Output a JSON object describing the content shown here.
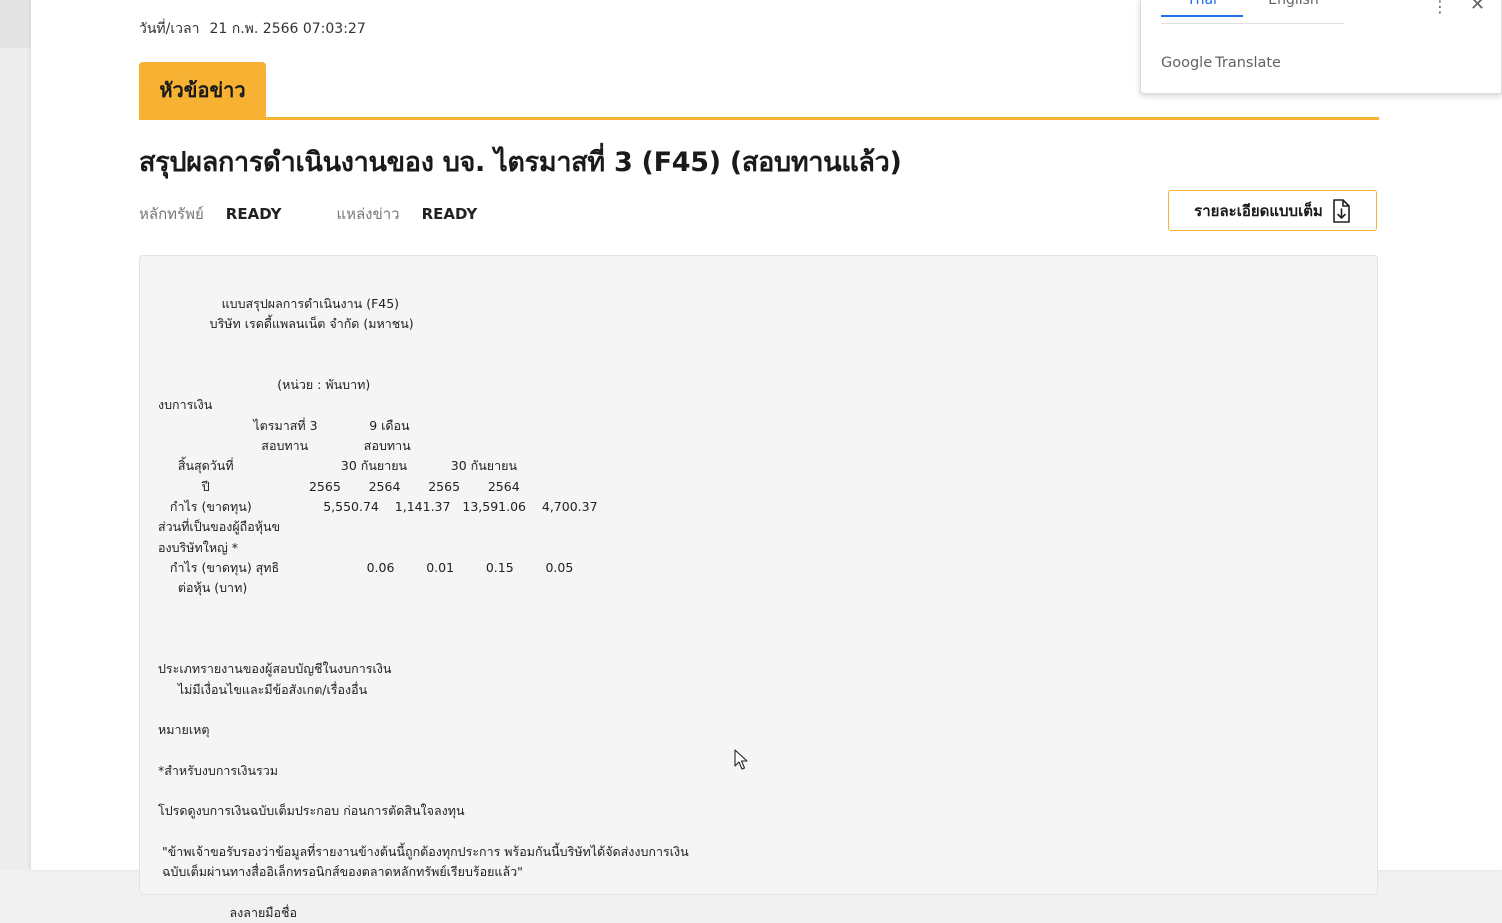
{
  "news": {
    "datetime_label": "วันที่/เวลา",
    "datetime_value": "21 ก.พ. 2566 07:03:27",
    "headline_tab": "หัวข้อข่าว",
    "title": "สรุปผลการดำเนินงานของ บจ. ไตรมาสที่ 3 (F45) (สอบทานแล้ว)",
    "security_label": "หลักทรัพย์",
    "security_value": "READY",
    "source_label": "แหล่งข่าว",
    "source_value": "READY",
    "full_detail_button": "รายละเอียดแบบเต็ม",
    "full_detail_icon": "document-download-icon"
  },
  "report_lines": [
    "                แบบสรุปผลการดำเนินงาน (F45)",
    "             บริษัท เรดดี้แพลนเน็ต จำกัด (มหาชน)",
    "",
    "",
    "                              (หน่วย : พันบาท)",
    "งบการเงิน",
    "                        ไตรมาสที่ 3             9 เดือน",
    "                          สอบทาน              สอบทาน",
    "     สิ้นสุดวันที่                           30 กันยายน           30 กันยายน",
    "           ปี                         2565       2564       2565       2564",
    "   กำไร (ขาดทุน)                  5,550.74    1,141.37   13,591.06    4,700.37",
    "ส่วนที่เป็นของผู้ถือหุ้นข",
    "องบริษัทใหญ่ *",
    "   กำไร (ขาดทุน) สุทธิ                      0.06        0.01        0.15        0.05",
    "     ต่อหุ้น (บาท)",
    "",
    "",
    "",
    "ประเภทรายงานของผู้สอบบัญชีในงบการเงิน",
    "     ไม่มีเงื่อนไขและมีข้อสังเกต/เรื่องอื่น",
    "",
    "หมายเหตุ",
    "",
    "*สำหรับงบการเงินรวม",
    "",
    "โปรดดูงบการเงินฉบับเต็มประกอบ ก่อนการตัดสินใจลงทุน",
    "",
    " \"ข้าพเจ้าขอรับรองว่าข้อมูลที่รายงานข้างต้นนี้ถูกต้องทุกประการ พร้อมกันนี้บริษัทได้จัดส่งงบการเงิน",
    " ฉบับเต็มผ่านทางสื่ออิเล็กทรอนิกส์ของตลาดหลักทรัพย์เรียบร้อยแล้ว\"",
    "",
    "                  ลงลายมือชื่อ"
  ],
  "translate_popup": {
    "tab_active": "Thai",
    "tab_inactive": "English",
    "more_icon": "more-vertical-icon",
    "close_icon": "close-icon",
    "brand_google": "Google",
    "brand_translate": "Translate"
  },
  "colors": {
    "accent": "#f7b133",
    "translate_active": "#1a73e8",
    "content_bg": "#f5f5f5"
  }
}
